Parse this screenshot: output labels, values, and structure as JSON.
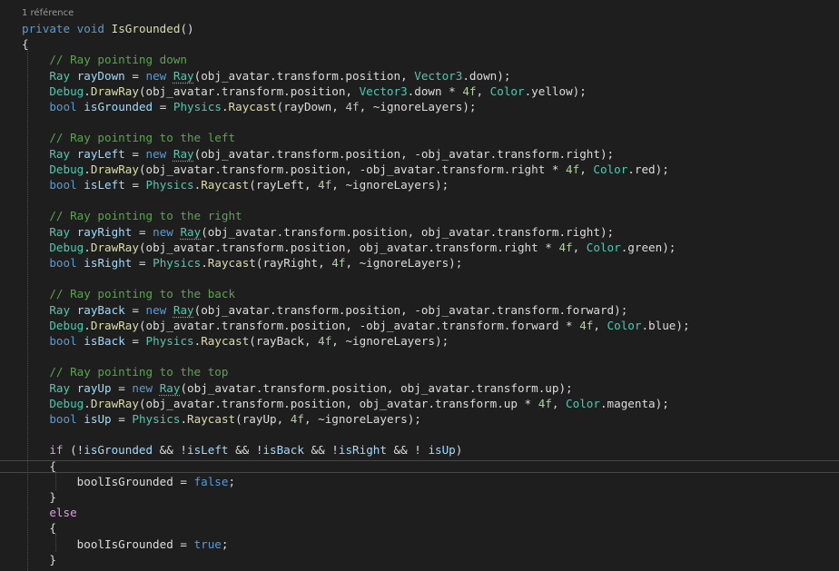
{
  "codelens": "1 référence",
  "lines": [
    [
      {
        "c": "kw",
        "t": "private"
      },
      {
        "c": "",
        "t": " "
      },
      {
        "c": "kw",
        "t": "void"
      },
      {
        "c": "",
        "t": " "
      },
      {
        "c": "fn",
        "t": "IsGrounded"
      },
      {
        "c": "",
        "t": "()"
      }
    ],
    [
      {
        "c": "",
        "t": "{"
      }
    ],
    [
      {
        "c": "cm",
        "t": "    // Ray pointing down"
      }
    ],
    [
      {
        "c": "",
        "t": "    "
      },
      {
        "c": "ty",
        "t": "Ray"
      },
      {
        "c": "",
        "t": " "
      },
      {
        "c": "var",
        "t": "rayDown"
      },
      {
        "c": "",
        "t": " = "
      },
      {
        "c": "kw",
        "t": "new"
      },
      {
        "c": "",
        "t": " "
      },
      {
        "c": "ty sq",
        "t": "Ray"
      },
      {
        "c": "",
        "t": "(obj_avatar.transform.position, "
      },
      {
        "c": "ty",
        "t": "Vector3"
      },
      {
        "c": "",
        "t": ".down);"
      }
    ],
    [
      {
        "c": "",
        "t": "    "
      },
      {
        "c": "ty",
        "t": "Debug"
      },
      {
        "c": "",
        "t": "."
      },
      {
        "c": "fn",
        "t": "DrawRay"
      },
      {
        "c": "",
        "t": "(obj_avatar.transform.position, "
      },
      {
        "c": "ty",
        "t": "Vector3"
      },
      {
        "c": "",
        "t": ".down * "
      },
      {
        "c": "num",
        "t": "4f"
      },
      {
        "c": "",
        "t": ", "
      },
      {
        "c": "ty",
        "t": "Color"
      },
      {
        "c": "",
        "t": ".yellow);"
      }
    ],
    [
      {
        "c": "",
        "t": "    "
      },
      {
        "c": "kw",
        "t": "bool"
      },
      {
        "c": "",
        "t": " "
      },
      {
        "c": "var",
        "t": "isGrounded"
      },
      {
        "c": "",
        "t": " = "
      },
      {
        "c": "ty",
        "t": "Physics"
      },
      {
        "c": "",
        "t": "."
      },
      {
        "c": "fn",
        "t": "Raycast"
      },
      {
        "c": "",
        "t": "(rayDown, "
      },
      {
        "c": "num",
        "t": "4f"
      },
      {
        "c": "",
        "t": ", ~ignoreLayers);"
      }
    ],
    [],
    [
      {
        "c": "cm",
        "t": "    // Ray pointing to the left"
      }
    ],
    [
      {
        "c": "",
        "t": "    "
      },
      {
        "c": "ty",
        "t": "Ray"
      },
      {
        "c": "",
        "t": " "
      },
      {
        "c": "var",
        "t": "rayLeft"
      },
      {
        "c": "",
        "t": " = "
      },
      {
        "c": "kw",
        "t": "new"
      },
      {
        "c": "",
        "t": " "
      },
      {
        "c": "ty sq",
        "t": "Ray"
      },
      {
        "c": "",
        "t": "(obj_avatar.transform.position, -obj_avatar.transform.right);"
      }
    ],
    [
      {
        "c": "",
        "t": "    "
      },
      {
        "c": "ty",
        "t": "Debug"
      },
      {
        "c": "",
        "t": "."
      },
      {
        "c": "fn",
        "t": "DrawRay"
      },
      {
        "c": "",
        "t": "(obj_avatar.transform.position, -obj_avatar.transform.right * "
      },
      {
        "c": "num",
        "t": "4f"
      },
      {
        "c": "",
        "t": ", "
      },
      {
        "c": "ty",
        "t": "Color"
      },
      {
        "c": "",
        "t": ".red);"
      }
    ],
    [
      {
        "c": "",
        "t": "    "
      },
      {
        "c": "kw",
        "t": "bool"
      },
      {
        "c": "",
        "t": " "
      },
      {
        "c": "var",
        "t": "isLeft"
      },
      {
        "c": "",
        "t": " = "
      },
      {
        "c": "ty",
        "t": "Physics"
      },
      {
        "c": "",
        "t": "."
      },
      {
        "c": "fn",
        "t": "Raycast"
      },
      {
        "c": "",
        "t": "(rayLeft, "
      },
      {
        "c": "num",
        "t": "4f"
      },
      {
        "c": "",
        "t": ", ~ignoreLayers);"
      }
    ],
    [],
    [
      {
        "c": "cm",
        "t": "    // Ray pointing to the right"
      }
    ],
    [
      {
        "c": "",
        "t": "    "
      },
      {
        "c": "ty",
        "t": "Ray"
      },
      {
        "c": "",
        "t": " "
      },
      {
        "c": "var",
        "t": "rayRight"
      },
      {
        "c": "",
        "t": " = "
      },
      {
        "c": "kw",
        "t": "new"
      },
      {
        "c": "",
        "t": " "
      },
      {
        "c": "ty sq",
        "t": "Ray"
      },
      {
        "c": "",
        "t": "(obj_avatar.transform.position, obj_avatar.transform.right);"
      }
    ],
    [
      {
        "c": "",
        "t": "    "
      },
      {
        "c": "ty",
        "t": "Debug"
      },
      {
        "c": "",
        "t": "."
      },
      {
        "c": "fn",
        "t": "DrawRay"
      },
      {
        "c": "",
        "t": "(obj_avatar.transform.position, obj_avatar.transform.right * "
      },
      {
        "c": "num",
        "t": "4f"
      },
      {
        "c": "",
        "t": ", "
      },
      {
        "c": "ty",
        "t": "Color"
      },
      {
        "c": "",
        "t": ".green);"
      }
    ],
    [
      {
        "c": "",
        "t": "    "
      },
      {
        "c": "kw",
        "t": "bool"
      },
      {
        "c": "",
        "t": " "
      },
      {
        "c": "var",
        "t": "isRight"
      },
      {
        "c": "",
        "t": " = "
      },
      {
        "c": "ty",
        "t": "Physics"
      },
      {
        "c": "",
        "t": "."
      },
      {
        "c": "fn",
        "t": "Raycast"
      },
      {
        "c": "",
        "t": "(rayRight, "
      },
      {
        "c": "num",
        "t": "4f"
      },
      {
        "c": "",
        "t": ", ~ignoreLayers);"
      }
    ],
    [],
    [
      {
        "c": "cm",
        "t": "    // Ray pointing to the back"
      }
    ],
    [
      {
        "c": "",
        "t": "    "
      },
      {
        "c": "ty",
        "t": "Ray"
      },
      {
        "c": "",
        "t": " "
      },
      {
        "c": "var",
        "t": "rayBack"
      },
      {
        "c": "",
        "t": " = "
      },
      {
        "c": "kw",
        "t": "new"
      },
      {
        "c": "",
        "t": " "
      },
      {
        "c": "ty sq",
        "t": "Ray"
      },
      {
        "c": "",
        "t": "(obj_avatar.transform.position, -obj_avatar.transform.forward);"
      }
    ],
    [
      {
        "c": "",
        "t": "    "
      },
      {
        "c": "ty",
        "t": "Debug"
      },
      {
        "c": "",
        "t": "."
      },
      {
        "c": "fn",
        "t": "DrawRay"
      },
      {
        "c": "",
        "t": "(obj_avatar.transform.position, -obj_avatar.transform.forward * "
      },
      {
        "c": "num",
        "t": "4f"
      },
      {
        "c": "",
        "t": ", "
      },
      {
        "c": "ty",
        "t": "Color"
      },
      {
        "c": "",
        "t": ".blue);"
      }
    ],
    [
      {
        "c": "",
        "t": "    "
      },
      {
        "c": "kw",
        "t": "bool"
      },
      {
        "c": "",
        "t": " "
      },
      {
        "c": "var",
        "t": "isBack"
      },
      {
        "c": "",
        "t": " = "
      },
      {
        "c": "ty",
        "t": "Physics"
      },
      {
        "c": "",
        "t": "."
      },
      {
        "c": "fn",
        "t": "Raycast"
      },
      {
        "c": "",
        "t": "(rayBack, "
      },
      {
        "c": "num",
        "t": "4f"
      },
      {
        "c": "",
        "t": ", ~ignoreLayers);"
      }
    ],
    [],
    [
      {
        "c": "cm",
        "t": "    // Ray pointing to the top"
      }
    ],
    [
      {
        "c": "",
        "t": "    "
      },
      {
        "c": "ty",
        "t": "Ray"
      },
      {
        "c": "",
        "t": " "
      },
      {
        "c": "var",
        "t": "rayUp"
      },
      {
        "c": "",
        "t": " = "
      },
      {
        "c": "kw",
        "t": "new"
      },
      {
        "c": "",
        "t": " "
      },
      {
        "c": "ty sq",
        "t": "Ray"
      },
      {
        "c": "",
        "t": "(obj_avatar.transform.position, obj_avatar.transform.up);"
      }
    ],
    [
      {
        "c": "",
        "t": "    "
      },
      {
        "c": "ty",
        "t": "Debug"
      },
      {
        "c": "",
        "t": "."
      },
      {
        "c": "fn",
        "t": "DrawRay"
      },
      {
        "c": "",
        "t": "(obj_avatar.transform.position, obj_avatar.transform.up * "
      },
      {
        "c": "num",
        "t": "4f"
      },
      {
        "c": "",
        "t": ", "
      },
      {
        "c": "ty",
        "t": "Color"
      },
      {
        "c": "",
        "t": ".magenta);"
      }
    ],
    [
      {
        "c": "",
        "t": "    "
      },
      {
        "c": "kw",
        "t": "bool"
      },
      {
        "c": "",
        "t": " "
      },
      {
        "c": "var",
        "t": "isUp"
      },
      {
        "c": "",
        "t": " = "
      },
      {
        "c": "ty",
        "t": "Physics"
      },
      {
        "c": "",
        "t": "."
      },
      {
        "c": "fn",
        "t": "Raycast"
      },
      {
        "c": "",
        "t": "(rayUp, "
      },
      {
        "c": "num",
        "t": "4f"
      },
      {
        "c": "",
        "t": ", ~ignoreLayers);"
      }
    ],
    [],
    [
      {
        "c": "",
        "t": "    "
      },
      {
        "c": "ctl",
        "t": "if"
      },
      {
        "c": "",
        "t": " (!"
      },
      {
        "c": "var",
        "t": "isGrounded"
      },
      {
        "c": "",
        "t": " && !"
      },
      {
        "c": "var",
        "t": "isLeft"
      },
      {
        "c": "",
        "t": " && !"
      },
      {
        "c": "var",
        "t": "isBack"
      },
      {
        "c": "",
        "t": " && !"
      },
      {
        "c": "var",
        "t": "isRight"
      },
      {
        "c": "",
        "t": " && ! "
      },
      {
        "c": "var",
        "t": "isUp"
      },
      {
        "c": "",
        "t": ")"
      }
    ],
    [
      {
        "c": "",
        "t": "    {"
      }
    ],
    [
      {
        "c": "",
        "t": "        boolIsGrounded = "
      },
      {
        "c": "kw",
        "t": "false"
      },
      {
        "c": "",
        "t": ";"
      }
    ],
    [
      {
        "c": "",
        "t": "    }"
      }
    ],
    [
      {
        "c": "",
        "t": "    "
      },
      {
        "c": "ctl",
        "t": "else"
      }
    ],
    [
      {
        "c": "",
        "t": "    {"
      }
    ],
    [
      {
        "c": "",
        "t": "        boolIsGrounded = "
      },
      {
        "c": "kw",
        "t": "true"
      },
      {
        "c": "",
        "t": ";"
      }
    ],
    [
      {
        "c": "",
        "t": "    }"
      }
    ],
    [
      {
        "c": "",
        "t": ""
      }
    ]
  ]
}
